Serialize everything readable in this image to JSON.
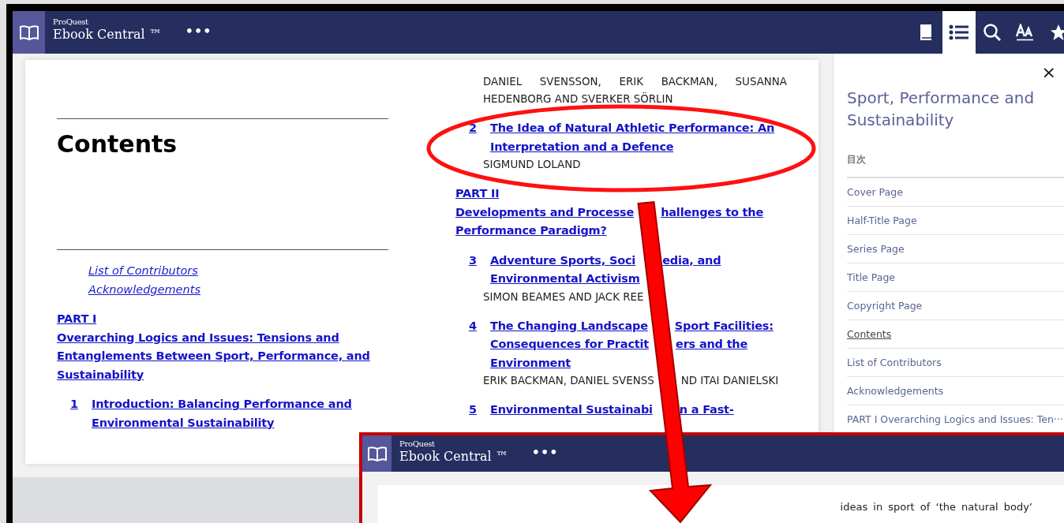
{
  "app": {
    "brand_small": "ProQuest",
    "brand": "Ebook Central ™",
    "more": "•••"
  },
  "toolbar": [
    {
      "kind": "book",
      "selected": false
    },
    {
      "kind": "toc",
      "selected": true
    },
    {
      "kind": "search",
      "selected": false
    },
    {
      "kind": "font",
      "selected": false
    },
    {
      "kind": "star",
      "selected": false
    }
  ],
  "page": {
    "heading": "Contents",
    "front_links": [
      "List of Contributors",
      "Acknowledgements"
    ],
    "left": [
      {
        "kind": "part",
        "label": "PART I",
        "title": "Overarching Logics and Issues: Tensions and Entanglements Between Sport, Performance, and Sustainability"
      },
      {
        "kind": "chapter",
        "number": "1",
        "title": "Introduction: Balancing Performance and Environmental Sustainability"
      }
    ],
    "right": [
      {
        "kind": "authors",
        "lines": [
          [
            "DANIEL SVENSSON, ERIK BACKMAN, SUSANNA HEDENBORG AND SVERKER SÖRLIN"
          ]
        ]
      },
      {
        "kind": "chapter",
        "number": "2",
        "lines": [
          [
            "The Idea of Natural Athletic Performance: An"
          ],
          [
            "Interpretation and a Defence"
          ]
        ]
      },
      {
        "kind": "authors",
        "lines": [
          [
            "SIGMUND LOLAND"
          ]
        ]
      },
      {
        "kind": "part",
        "label": "PART II",
        "lines": [
          [
            "Developments and Processe",
            "hallenges to the"
          ],
          [
            "Performance Paradigm?"
          ]
        ]
      },
      {
        "kind": "chapter",
        "number": "3",
        "lines": [
          [
            "Adventure Sports, Soci",
            "edia, and"
          ],
          [
            "Environmental Activism"
          ]
        ]
      },
      {
        "kind": "authors",
        "lines": [
          [
            "SIMON BEAMES AND JACK REE"
          ]
        ]
      },
      {
        "kind": "chapter",
        "number": "4",
        "lines": [
          [
            "The Changing Landscape",
            "Sport Facilities:"
          ],
          [
            "Consequences for Practit",
            "ers and the"
          ],
          [
            "Environment"
          ]
        ]
      },
      {
        "kind": "authors",
        "lines": [
          [
            "ERIK BACKMAN, DANIEL SVENSS",
            "ND ITAI DANIELSKI"
          ]
        ]
      },
      {
        "kind": "chapter",
        "number": "5",
        "lines": [
          [
            "Environmental Sustainabi",
            "n a Fast-"
          ]
        ]
      }
    ]
  },
  "sidebar": {
    "close": "×",
    "title": "Sport, Performance and Sustainability",
    "toc_label": "目次",
    "items": [
      {
        "label": "Cover Page",
        "selected": false
      },
      {
        "label": "Half-Title Page",
        "selected": false
      },
      {
        "label": "Series Page",
        "selected": false
      },
      {
        "label": "Title Page",
        "selected": false
      },
      {
        "label": "Copyright Page",
        "selected": false
      },
      {
        "label": "Contents",
        "selected": true
      },
      {
        "label": "List of Contributors",
        "selected": false
      },
      {
        "label": "Acknowledgements",
        "selected": false
      },
      {
        "label": "PART I Overarching Logics and Issues: Ten···",
        "selected": false
      }
    ]
  },
  "inset": {
    "brand_small": "ProQuest",
    "brand": "Ebook Central ™",
    "more": "•••",
    "text": "ideas in sport of ‘the natural body’"
  }
}
